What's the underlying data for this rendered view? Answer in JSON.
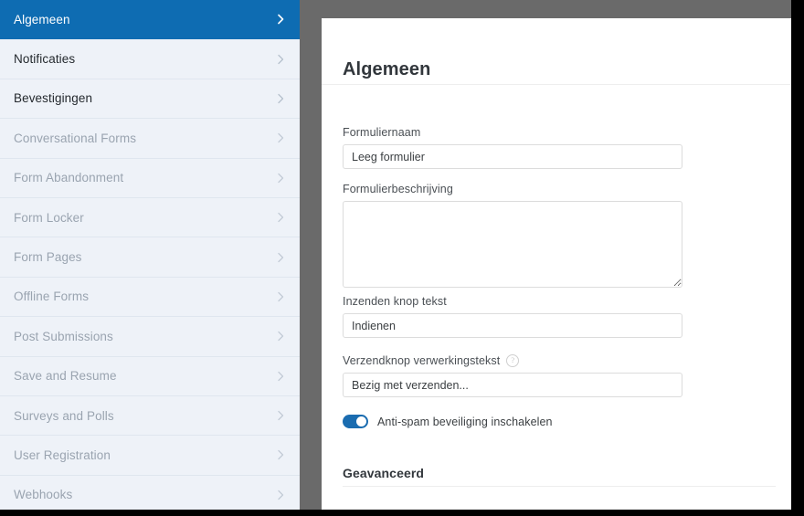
{
  "theme": {
    "accent": "#0e6cb2",
    "backdrop": "#6a6a6a",
    "sidebar_bg": "#eef2f8",
    "panel_bg": "#ffffff",
    "toggle_on": "#1a6cb0",
    "disabled_text": "#9aa4b0",
    "active_text": "#ffffff"
  },
  "sidebar": {
    "items": [
      {
        "label": "Algemeen",
        "state": "active",
        "chevron": "chevron-right-icon"
      },
      {
        "label": "Notificaties",
        "state": "enabled",
        "chevron": "chevron-right-icon"
      },
      {
        "label": "Bevestigingen",
        "state": "enabled",
        "chevron": "chevron-right-icon"
      },
      {
        "label": "Conversational Forms",
        "state": "disabled",
        "chevron": "chevron-right-icon"
      },
      {
        "label": "Form Abandonment",
        "state": "disabled",
        "chevron": "chevron-right-icon"
      },
      {
        "label": "Form Locker",
        "state": "disabled",
        "chevron": "chevron-right-icon"
      },
      {
        "label": "Form Pages",
        "state": "disabled",
        "chevron": "chevron-right-icon"
      },
      {
        "label": "Offline Forms",
        "state": "disabled",
        "chevron": "chevron-right-icon"
      },
      {
        "label": "Post Submissions",
        "state": "disabled",
        "chevron": "chevron-right-icon"
      },
      {
        "label": "Save and Resume",
        "state": "disabled",
        "chevron": "chevron-right-icon"
      },
      {
        "label": "Surveys and Polls",
        "state": "disabled",
        "chevron": "chevron-right-icon"
      },
      {
        "label": "User Registration",
        "state": "disabled",
        "chevron": "chevron-right-icon"
      },
      {
        "label": "Webhooks",
        "state": "disabled",
        "chevron": "chevron-right-icon"
      }
    ]
  },
  "panel": {
    "title": "Algemeen",
    "fields": {
      "form_name": {
        "label": "Formuliernaam",
        "value": "Leeg formulier",
        "placeholder": ""
      },
      "form_description": {
        "label": "Formulierbeschrijving",
        "value": "",
        "placeholder": ""
      },
      "submit_button_text": {
        "label": "Inzenden knop tekst",
        "value": "Indienen",
        "placeholder": ""
      },
      "submit_processing_text": {
        "label": "Verzendknop verwerkingstekst",
        "value": "Bezig met verzenden...",
        "placeholder": "Bezig met verzenden...",
        "help_icon": "question-mark-help-icon"
      }
    },
    "antispam_toggle": {
      "label": "Anti-spam beveiliging inschakelen",
      "state": "on"
    },
    "advanced_section": {
      "title": "Geavanceerd"
    }
  }
}
